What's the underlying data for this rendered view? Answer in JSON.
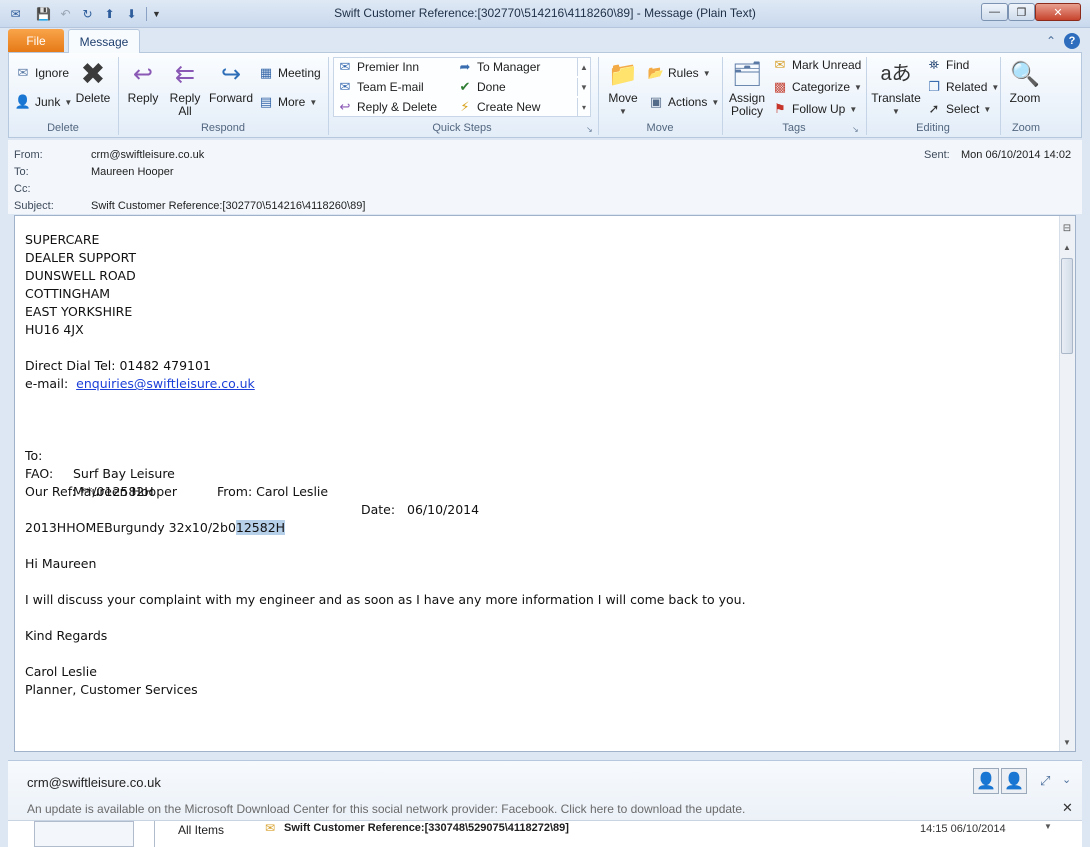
{
  "window": {
    "title": "Swift Customer Reference:[302770\\514216\\4118260\\89]  -  Message (Plain Text)",
    "controls": {
      "minimize": "—",
      "maximize": "❐",
      "close": "✕"
    }
  },
  "qat": {
    "save_icon": "save-icon",
    "undo_icon": "undo-icon",
    "refresh_icon": "refresh-icon",
    "up_icon": "up-arrow-icon",
    "down_icon": "down-arrow-icon",
    "customize_icon": "customize-icon"
  },
  "tabs": {
    "file": "File",
    "message": "Message"
  },
  "ribbon": {
    "delete_group": {
      "label": "Delete",
      "ignore": "Ignore",
      "junk": "Junk",
      "delete": "Delete"
    },
    "respond_group": {
      "label": "Respond",
      "reply": "Reply",
      "reply_all_1": "Reply",
      "reply_all_2": "All",
      "forward": "Forward",
      "meeting": "Meeting",
      "more": "More"
    },
    "quick_steps": {
      "label": "Quick Steps",
      "items": [
        "Premier Inn",
        "To Manager",
        "Team E-mail",
        "Done",
        "Reply & Delete",
        "Create New"
      ]
    },
    "move_group": {
      "label": "Move",
      "move": "Move",
      "rules": "Rules",
      "actions": "Actions"
    },
    "tags_group": {
      "label": "Tags",
      "assign_1": "Assign",
      "assign_2": "Policy",
      "mark_unread": "Mark Unread",
      "categorize": "Categorize",
      "follow_up": "Follow Up"
    },
    "editing_group": {
      "label": "Editing",
      "translate": "Translate",
      "find": "Find",
      "related": "Related",
      "select": "Select"
    },
    "zoom_group": {
      "label": "Zoom",
      "zoom": "Zoom"
    }
  },
  "header": {
    "from_label": "From:",
    "from_value": "crm@swiftleisure.co.uk",
    "to_label": "To:",
    "to_value": "Maureen Hooper",
    "cc_label": "Cc:",
    "cc_value": "",
    "subject_label": "Subject:",
    "subject_value": "Swift Customer Reference:[302770\\514216\\4118260\\89]",
    "sent_label": "Sent:",
    "sent_value": "Mon 06/10/2014 14:02"
  },
  "body": {
    "address": [
      "SUPERCARE",
      "DEALER SUPPORT",
      "DUNSWELL ROAD",
      "COTTINGHAM",
      "EAST YORKSHIRE",
      "HU16 4JX"
    ],
    "direct_dial": "Direct Dial Tel: 01482 479101",
    "email_label": "e-mail:  ",
    "email_link": "enquiries@swiftleisure.co.uk",
    "to_label": "To:",
    "to_value": "Surf Bay Leisure",
    "from_text": "From: Carol Leslie",
    "fao_label": "FAO:",
    "fao_value": "Maureen Hooper",
    "date_text": "Date:   06/10/2014",
    "our_ref": "Our Ref: **/012582H",
    "product_prefix": "2013HHOMEBurgundy 32x10/2b0",
    "product_highlight": "12582H",
    "greeting": "Hi Maureen",
    "message": "I will discuss your complaint with my engineer and as soon as I have any more information I will come back to you.",
    "signoff": "Kind Regards",
    "sig_name": "Carol Leslie",
    "sig_title": "Planner, Customer Services"
  },
  "people_pane": {
    "sender": "crm@swiftleisure.co.uk",
    "update_notice": "An update is available on the Microsoft Download Center for this social network provider: Facebook. Click here to download the update.",
    "tab_all_items": "All Items",
    "item_subject": "Swift Customer Reference:[330748\\529075\\4118272\\89]",
    "item_time": "14:15  06/10/2014"
  }
}
